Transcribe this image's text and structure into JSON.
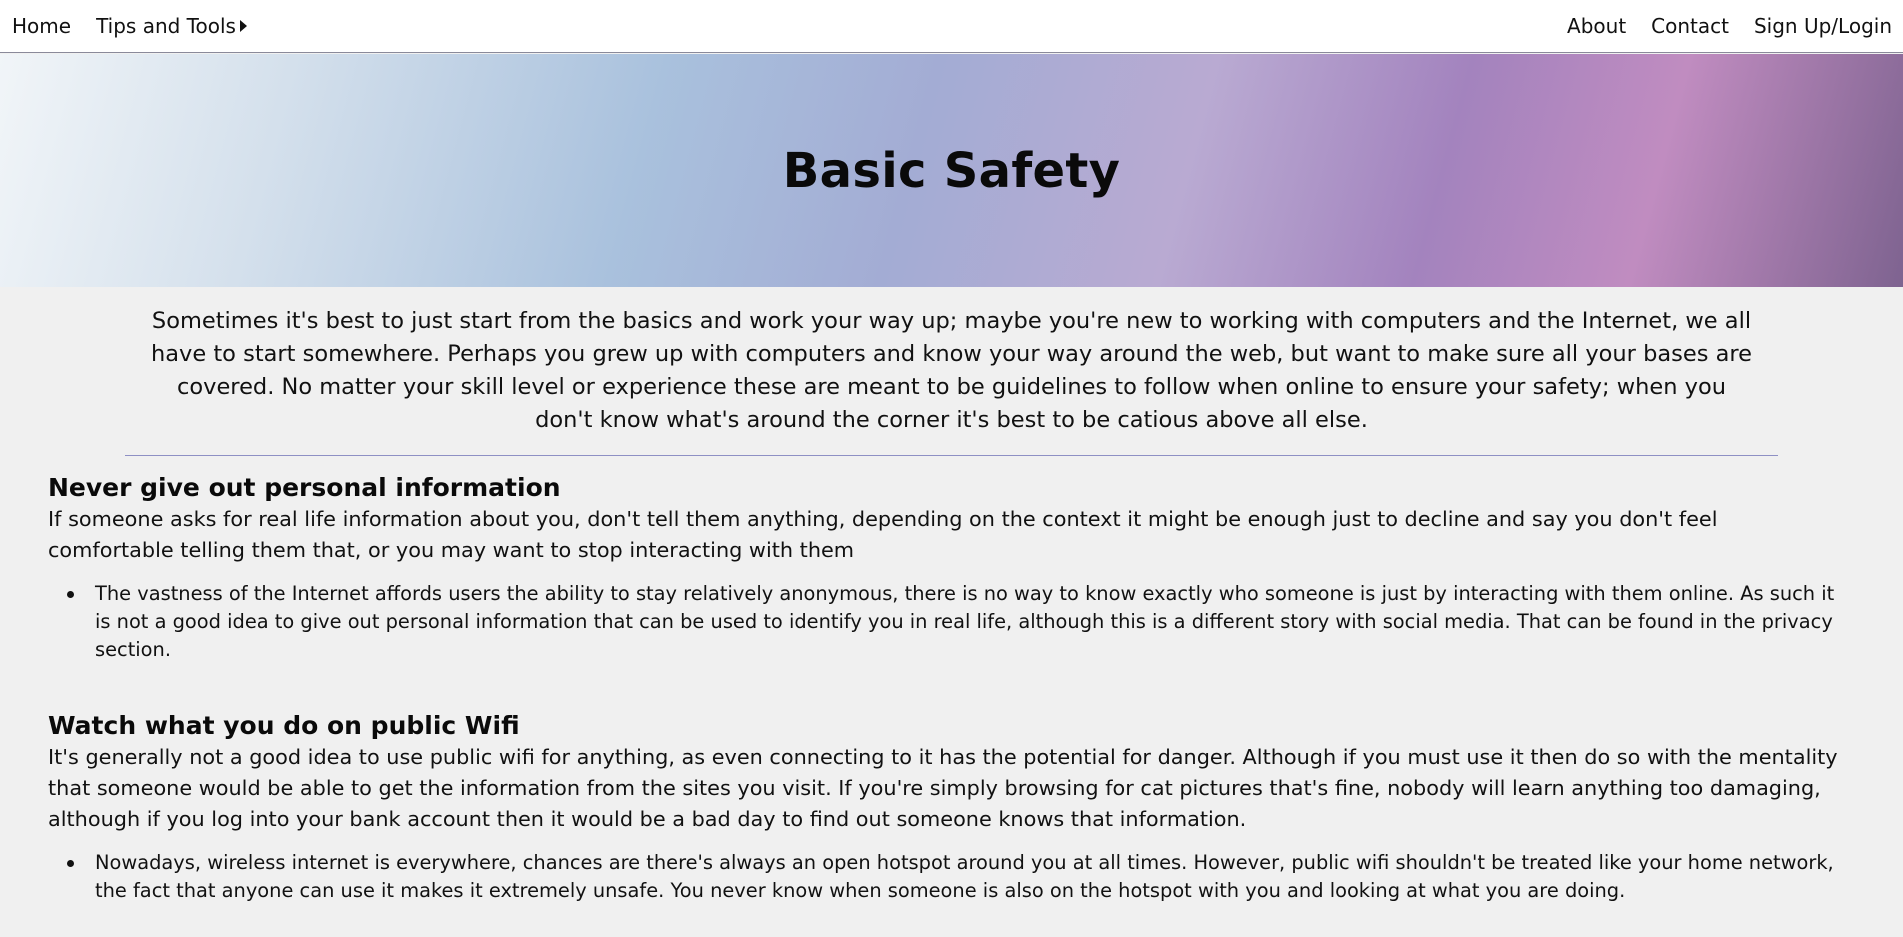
{
  "nav": {
    "left": [
      {
        "label": "Home"
      },
      {
        "label": "Tips and Tools"
      }
    ],
    "right": [
      {
        "label": "About"
      },
      {
        "label": "Contact"
      },
      {
        "label": "Sign Up/Login"
      }
    ],
    "dropdown_icon": "caret-right-icon"
  },
  "hero": {
    "title": "Basic Safety"
  },
  "intro": "Sometimes it's best to just start from the basics and work your way up; maybe you're new to working with computers and the Internet, we all have to start somewhere. Perhaps you grew up with computers and know your way around the web, but want to make sure all your bases are covered. No matter your skill level or experience these are meant to be guidelines to follow when online to ensure your safety; when you don't know what's around the corner it's best to be catious above all else.",
  "sections": [
    {
      "heading": "Never give out personal information",
      "body": "If someone asks for real life information about you, don't tell them anything, depending on the context it might be enough just to decline and say you don't feel comfortable telling them that, or you may want to stop interacting with them",
      "bullets": [
        "The vastness of the Internet affords users the ability to stay relatively anonymous, there is no way to know exactly who someone is just by interacting with them online. As such it is not a good idea to give out personal information that can be used to identify you in real life, although this is a different story with social media. That can be found in the privacy section."
      ]
    },
    {
      "heading": "Watch what you do on public Wifi",
      "body": "It's generally not a good idea to use public wifi for anything, as even connecting to it has the potential for danger. Although if you must use it then do so with the mentality that someone would be able to get the information from the sites you visit. If you're simply browsing for cat pictures that's fine, nobody will learn anything too damaging, although if you log into your bank account then it would be a bad day to find out someone knows that information.",
      "bullets": [
        "Nowadays, wireless internet is everywhere, chances are there's always an open hotspot around you at all times. However, public wifi shouldn't be treated like your home network, the fact that anyone can use it makes it extremely unsafe. You never know when someone is also on the hotspot with you and looking at what you are doing."
      ]
    }
  ],
  "colors": {
    "nav_bg": "#ffffff",
    "page_bg": "#f0f0f0",
    "divider": "#8e90c4",
    "hero_gradient": [
      "#f1f5f8",
      "#a9c1dd",
      "#b9aad2",
      "#c08cc0",
      "#7e6390"
    ]
  }
}
